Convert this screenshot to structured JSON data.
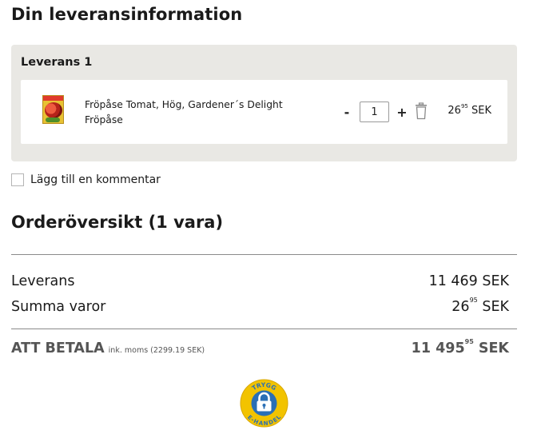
{
  "page": {
    "title": "Din leveransinformation"
  },
  "delivery": {
    "title": "Leverans 1",
    "item": {
      "name": "Fröpåse Tomat, Hög, Gardener´s Delight",
      "subtitle": "Fröpåse",
      "quantity": "1",
      "minus_label": "-",
      "plus_label": "+",
      "price_whole": "26",
      "price_ore": "95",
      "currency": "SEK"
    }
  },
  "comment": {
    "label": "Lägg till en kommentar"
  },
  "summary": {
    "title": "Orderöversikt (1 vara)",
    "rows": [
      {
        "label": "Leverans",
        "amount": "11 469 SEK"
      },
      {
        "label": "Summa varor",
        "amount_whole": "26",
        "amount_ore": "95",
        "currency": "SEK"
      }
    ],
    "total": {
      "label": "ATT BETALA",
      "note": "ink. moms (2299.19 SEK)",
      "amount_whole": "11 495",
      "amount_ore": "95",
      "currency": "SEK"
    }
  },
  "badge": {
    "top_text": "TRYGG",
    "bottom_text": "E-HANDEL",
    "icon": "lock-icon",
    "color": "#f2c300",
    "ring_color": "#2a6fb5"
  }
}
